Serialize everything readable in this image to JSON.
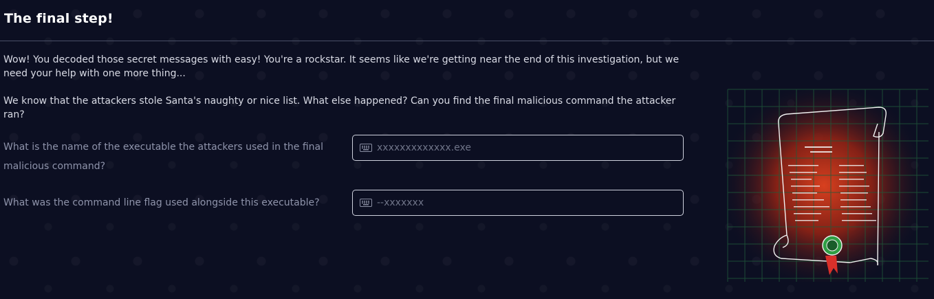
{
  "section": {
    "title": "The final step!",
    "paragraphs": [
      "Wow! You decoded those secret messages with easy! You're a rockstar. It seems like we're getting near the end of this investigation, but we need your help with one more thing...",
      "We know that the attackers stole Santa's naughty or nice list. What else happened? Can you find the final malicious command the attacker ran?"
    ]
  },
  "questions": [
    {
      "label": "What is the name of the executable the attackers used in the final malicious command?",
      "placeholder": "xxxxxxxxxxxxx.exe",
      "value": "",
      "icon": "keyboard-icon"
    },
    {
      "label": "What was the command line flag used alongside this executable?",
      "placeholder": "--xxxxxxx",
      "value": "",
      "icon": "keyboard-icon"
    }
  ],
  "illustration": {
    "name": "naughty-nice-list-scroll",
    "colors": {
      "glow": "#c8321a",
      "grid": "#1f5a3a",
      "seal": "#2f9e44",
      "ribbon": "#d9302a"
    }
  }
}
